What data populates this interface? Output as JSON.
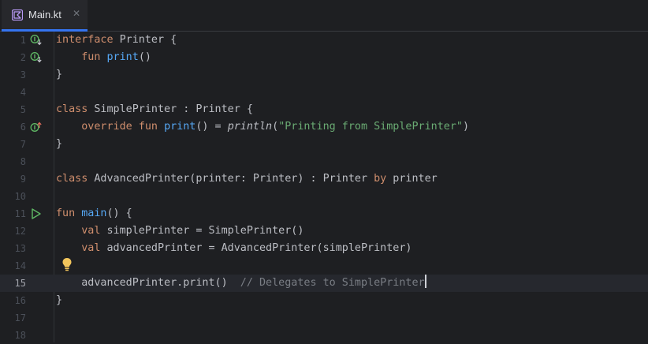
{
  "tab": {
    "filename": "Main.kt",
    "close_glyph": "✕",
    "accent": "#3574f0"
  },
  "lines": [
    {
      "num": "1",
      "tokens": [
        [
          "kw",
          "interface"
        ],
        [
          "t",
          " Printer {"
        ]
      ],
      "icon": "implemented-icon"
    },
    {
      "num": "2",
      "tokens": [
        [
          "t",
          "    "
        ],
        [
          "kw",
          "fun"
        ],
        [
          "t",
          " "
        ],
        [
          "fn",
          "print"
        ],
        [
          "t",
          "()"
        ]
      ],
      "icon": "implemented-icon"
    },
    {
      "num": "3",
      "tokens": [
        [
          "t",
          "}"
        ]
      ]
    },
    {
      "num": "4",
      "tokens": []
    },
    {
      "num": "5",
      "tokens": [
        [
          "kw",
          "class"
        ],
        [
          "t",
          " SimplePrinter : Printer {"
        ]
      ]
    },
    {
      "num": "6",
      "tokens": [
        [
          "t",
          "    "
        ],
        [
          "kw",
          "override fun"
        ],
        [
          "t",
          " "
        ],
        [
          "fn",
          "print"
        ],
        [
          "t",
          "() = "
        ],
        [
          "it",
          "println"
        ],
        [
          "t",
          "("
        ],
        [
          "str",
          "\"Printing from SimplePrinter\""
        ],
        [
          "t",
          ")"
        ]
      ],
      "icon": "implements-icon"
    },
    {
      "num": "7",
      "tokens": [
        [
          "t",
          "}"
        ]
      ]
    },
    {
      "num": "8",
      "tokens": []
    },
    {
      "num": "9",
      "tokens": [
        [
          "kw",
          "class"
        ],
        [
          "t",
          " AdvancedPrinter(printer: Printer) : Printer "
        ],
        [
          "kw",
          "by"
        ],
        [
          "t",
          " printer"
        ]
      ]
    },
    {
      "num": "10",
      "tokens": []
    },
    {
      "num": "11",
      "tokens": [
        [
          "kw",
          "fun"
        ],
        [
          "t",
          " "
        ],
        [
          "fn",
          "main"
        ],
        [
          "t",
          "() {"
        ]
      ],
      "icon": "run-icon"
    },
    {
      "num": "12",
      "tokens": [
        [
          "t",
          "    "
        ],
        [
          "kw",
          "val"
        ],
        [
          "t",
          " simplePrinter = SimplePrinter()"
        ]
      ]
    },
    {
      "num": "13",
      "tokens": [
        [
          "t",
          "    "
        ],
        [
          "kw",
          "val"
        ],
        [
          "t",
          " advancedPrinter = AdvancedPrinter(simplePrinter)"
        ]
      ]
    },
    {
      "num": "14",
      "tokens": []
    },
    {
      "num": "15",
      "tokens": [
        [
          "t",
          "    advancedPrinter.print()  "
        ],
        [
          "cm",
          "// Delegates to SimplePrinter"
        ]
      ],
      "current": true,
      "caret": true
    },
    {
      "num": "16",
      "tokens": [
        [
          "t",
          "}"
        ]
      ]
    },
    {
      "num": "17",
      "tokens": []
    },
    {
      "num": "18",
      "tokens": []
    }
  ],
  "intention_bulb": "lightbulb-icon",
  "colors": {
    "background": "#1e1f22",
    "keyword": "#cf8e6d",
    "function": "#56a8f5",
    "string": "#6aab73",
    "comment": "#7a7e85",
    "current_line": "#26282e"
  }
}
